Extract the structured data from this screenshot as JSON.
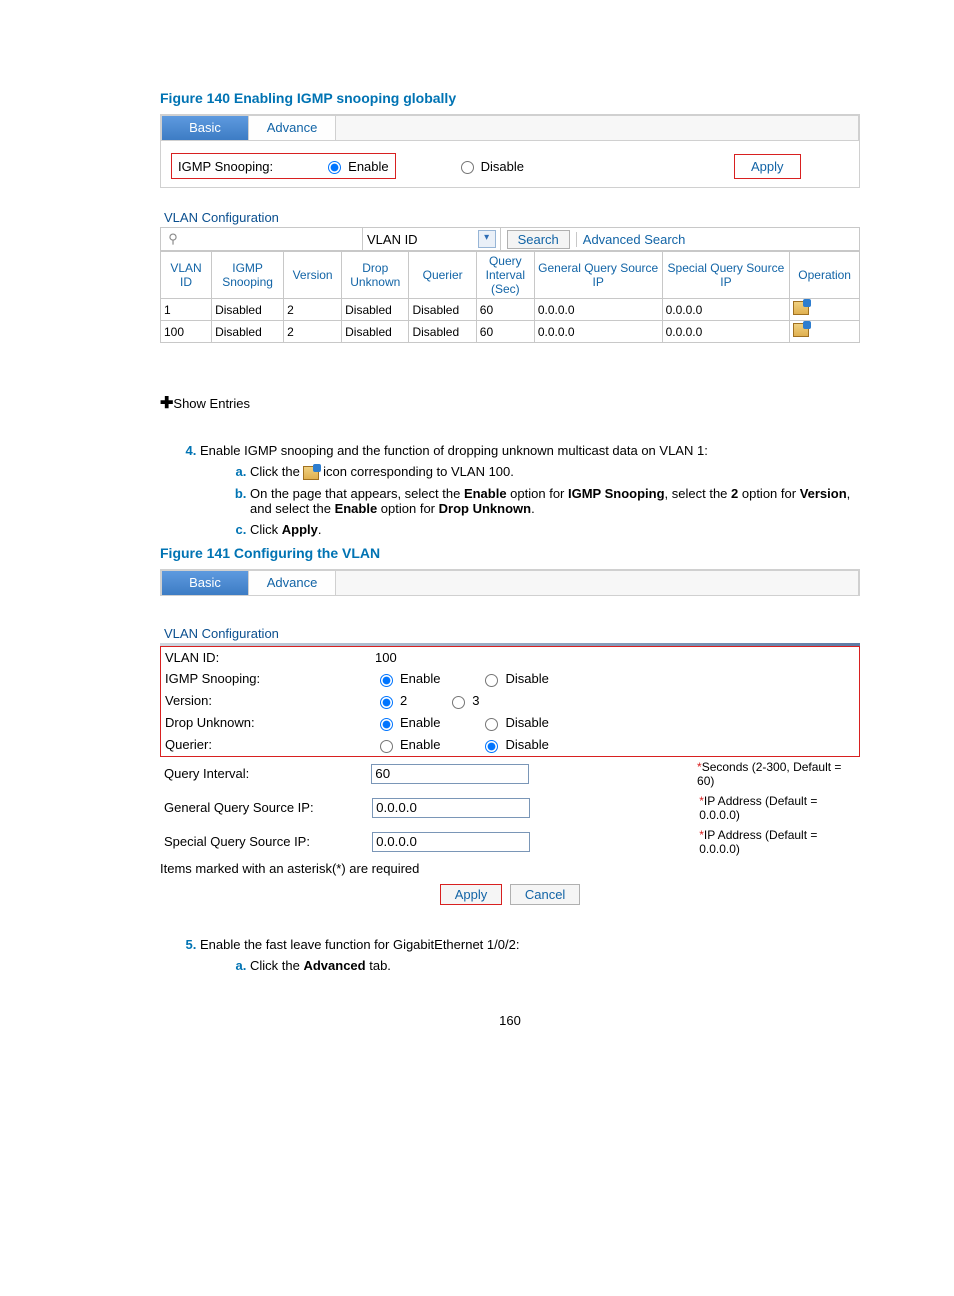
{
  "figure140": {
    "caption": "Figure 140 Enabling IGMP snooping globally",
    "tabs": {
      "basic": "Basic",
      "advance": "Advance"
    },
    "igmp_label": "IGMP Snooping:",
    "enable": "Enable",
    "disable": "Disable",
    "apply": "Apply",
    "section": "VLAN Configuration",
    "search_col": "VLAN ID",
    "search_btn": "Search",
    "adv_search": "Advanced Search",
    "headers": [
      "VLAN\nID",
      "IGMP\nSnooping",
      "Version",
      "Drop\nUnknown",
      "Querier",
      "Query\nInterval\n(Sec)",
      "General Query\nSource IP",
      "Special Query\nSource IP",
      "Operation"
    ],
    "rows": [
      {
        "vlan": "1",
        "snoop": "Disabled",
        "ver": "2",
        "drop": "Disabled",
        "quer": "Disabled",
        "qi": "60",
        "gq": "0.0.0.0",
        "sq": "0.0.0.0"
      },
      {
        "vlan": "100",
        "snoop": "Disabled",
        "ver": "2",
        "drop": "Disabled",
        "quer": "Disabled",
        "qi": "60",
        "gq": "0.0.0.0",
        "sq": "0.0.0.0"
      }
    ],
    "show_entries": "Show Entries"
  },
  "step4": {
    "num": "4.",
    "text": "Enable IGMP snooping and the function of dropping unknown multicast data on VLAN 1:",
    "a_pre": "Click the ",
    "a_post": " icon corresponding to VLAN 100.",
    "b": "On the page that appears, select the Enable option for IGMP Snooping, select the 2 option for Version, and select the Enable option for Drop Unknown.",
    "b_pre": "On the page that appears, select the ",
    "b_enable": "Enable",
    "b_opt_for": " option for ",
    "b_igmp": "IGMP Snooping",
    "b_sel": ", select the ",
    "b_two": "2",
    "b_version": "Version",
    "b_and": ", and select the ",
    "b_drop": "Drop Unknown",
    "b_end": ".",
    "c_pre": "Click ",
    "c_apply": "Apply",
    "c_end": "."
  },
  "figure141": {
    "caption": "Figure 141 Configuring the VLAN",
    "tabs": {
      "basic": "Basic",
      "advance": "Advance"
    },
    "section": "VLAN Configuration",
    "rows": {
      "vlan_id_label": "VLAN ID:",
      "vlan_id_value": "100",
      "igmp_label": "IGMP Snooping:",
      "version_label": "Version:",
      "version_opt1": "2",
      "version_opt2": "3",
      "drop_label": "Drop Unknown:",
      "querier_label": "Querier:",
      "enable": "Enable",
      "disable": "Disable",
      "qi_label": "Query Interval:",
      "qi_value": "60",
      "qi_help": "*Seconds (2-300, Default = 60)",
      "gq_label": "General Query Source IP:",
      "gq_value": "0.0.0.0",
      "gq_help": "*IP Address (Default = 0.0.0.0)",
      "sq_label": "Special Query Source IP:",
      "sq_value": "0.0.0.0",
      "sq_help": "*IP Address (Default = 0.0.0.0)"
    },
    "req_note": "Items marked with an asterisk(*) are required",
    "apply": "Apply",
    "cancel": "Cancel"
  },
  "step5": {
    "text": "Enable the fast leave function for GigabitEthernet 1/0/2:",
    "a_pre": "Click the ",
    "a_adv": "Advanced",
    "a_post": " tab."
  },
  "page_number": "160"
}
